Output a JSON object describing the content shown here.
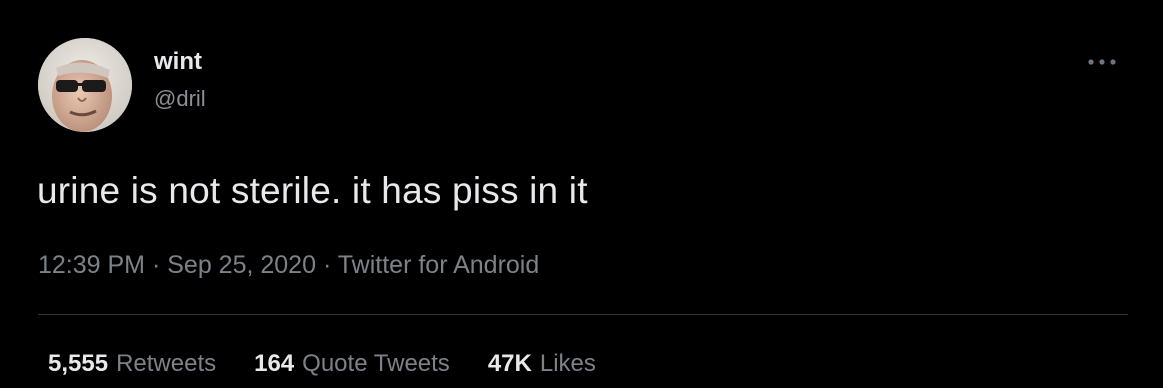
{
  "author": {
    "display_name": "wint",
    "handle": "@dril",
    "avatar_icon": "avatar-sunglasses-face"
  },
  "menu": {
    "icon": "more-dots-icon"
  },
  "tweet": {
    "text": "urine is not sterile. it has piss in it"
  },
  "meta": {
    "time": "12:39 PM",
    "separator": "·",
    "date": "Sep 25, 2020",
    "source": "Twitter for Android"
  },
  "stats": {
    "retweets": {
      "count": "5,555",
      "label": "Retweets"
    },
    "quote_tweets": {
      "count": "164",
      "label": "Quote Tweets"
    },
    "likes": {
      "count": "47K",
      "label": "Likes"
    }
  },
  "colors": {
    "background": "#000000",
    "primary_text": "#e7e9ea",
    "secondary_text": "#7d8287",
    "divider": "#2f3336"
  }
}
